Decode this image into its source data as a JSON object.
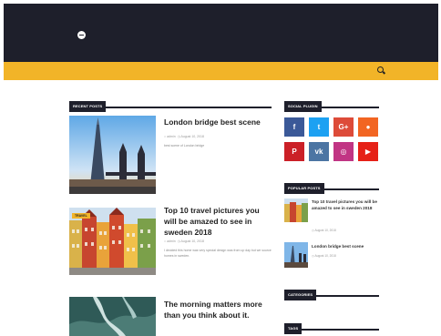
{
  "header": {
    "logo_icon": "circle-logo-icon",
    "search_icon": "search-icon",
    "colors": {
      "topbar": "#1e1f2b",
      "navbar": "#f2b428"
    }
  },
  "main": {
    "section_title": "RECENT POSTS",
    "posts": [
      {
        "title": "London bridge best scene",
        "author": "admin",
        "date": "August 10, 2018",
        "excerpt": "best scene of London bridge",
        "badge": ""
      },
      {
        "title": "Top 10 travel pictures you will be amazed to see in sweden 2018",
        "author": "admin",
        "date": "August 10, 2018",
        "excerpt": "I decided this home was very special design was from up day but we source homes in sweden.",
        "badge": "TRAVEL"
      },
      {
        "title": "The morning matters more than you think about it.",
        "author": "",
        "date": "",
        "excerpt": "",
        "badge": ""
      }
    ]
  },
  "sidebar": {
    "social_title": "SOCIAL PLUGIN",
    "social": [
      {
        "label": "f",
        "icon": "facebook-icon",
        "color": "#3b5998"
      },
      {
        "label": "t",
        "icon": "twitter-icon",
        "color": "#1da1f2"
      },
      {
        "label": "G+",
        "icon": "google-plus-icon",
        "color": "#dd4b39"
      },
      {
        "label": "●",
        "icon": "rss-icon",
        "color": "#f26522"
      },
      {
        "label": "P",
        "icon": "pinterest-icon",
        "color": "#cb2027"
      },
      {
        "label": "vk",
        "icon": "vk-icon",
        "color": "#4c75a3"
      },
      {
        "label": "◎",
        "icon": "instagram-icon",
        "color": "#c13584"
      },
      {
        "label": "▶",
        "icon": "youtube-icon",
        "color": "#e62117"
      }
    ],
    "popular_title": "POPULAR POSTS",
    "popular": [
      {
        "title": "Top 10 travel pictures you will be amazed to see in sweden 2018",
        "date": "August 10, 2018"
      },
      {
        "title": "London bridge best scene",
        "date": "August 10, 2018"
      }
    ],
    "categories_title": "CATEGORIES",
    "tags_title": "TAGS"
  }
}
